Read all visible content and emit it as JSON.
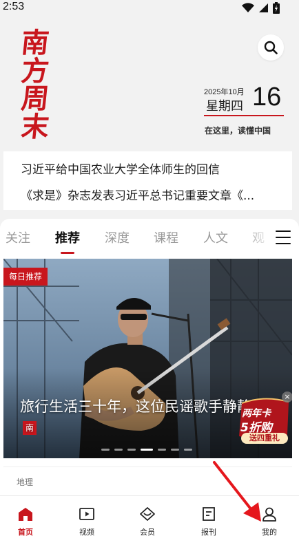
{
  "status": {
    "time": "2:53"
  },
  "brand": {
    "logo_chars": [
      "南",
      "方",
      "周",
      "末"
    ],
    "accent": "#c8161d"
  },
  "header": {
    "search_icon": "search-icon",
    "date_year_month": "2025年10月",
    "weekday": "星期四",
    "day": "16",
    "slogan": "在这里，读懂中国"
  },
  "headlines": [
    "习近平给中国农业大学全体师生的回信",
    "《求是》杂志发表习近平总书记重要文章《..."
  ],
  "tabs": [
    {
      "label": "关注",
      "active": false
    },
    {
      "label": "推荐",
      "active": true
    },
    {
      "label": "深度",
      "active": false
    },
    {
      "label": "课程",
      "active": false
    },
    {
      "label": "人文",
      "active": false
    },
    {
      "label": "观",
      "active": false
    }
  ],
  "hero": {
    "badge": "每日推荐",
    "title": "旅行生活三十年，这位民谣歌手静静",
    "mark": "南",
    "slide_count": 7,
    "active_slide": 4
  },
  "promo": {
    "line1": "两年卡",
    "line2": "5折购",
    "line3": "送四重礼",
    "close": "×"
  },
  "article": {
    "category": "地理"
  },
  "bottom_nav": [
    {
      "label": "首页",
      "icon": "home-icon",
      "active": true
    },
    {
      "label": "视频",
      "icon": "video-icon",
      "active": false
    },
    {
      "label": "会员",
      "icon": "member-icon",
      "active": false
    },
    {
      "label": "报刊",
      "icon": "newspaper-icon",
      "active": false
    },
    {
      "label": "我的",
      "icon": "profile-icon",
      "active": false
    }
  ]
}
